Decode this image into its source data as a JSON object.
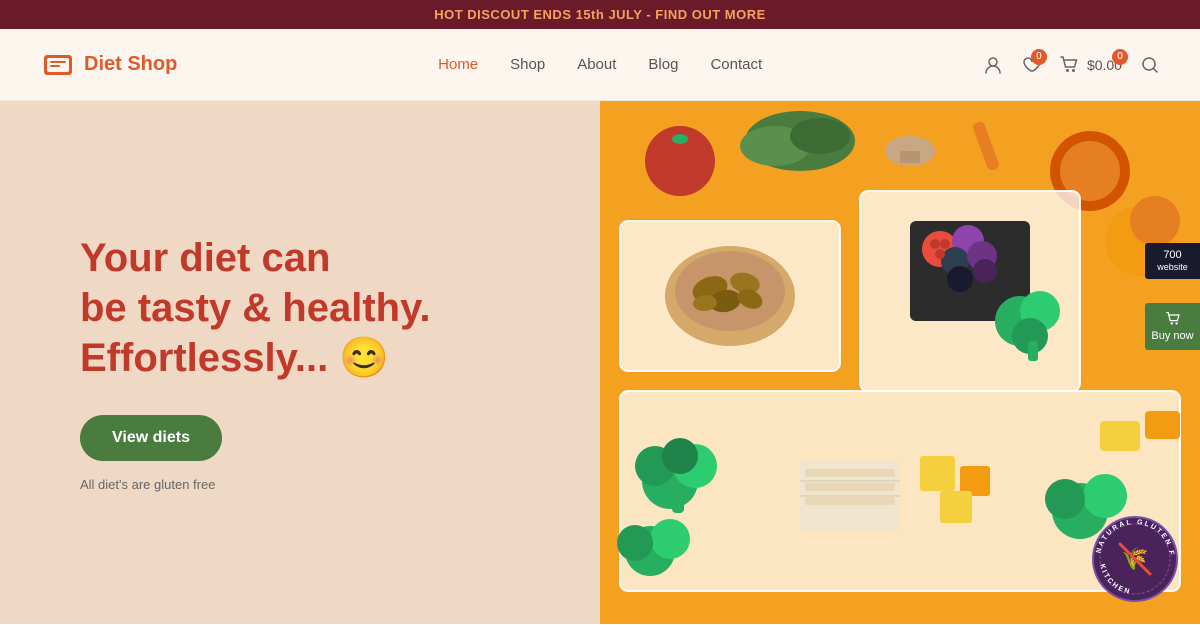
{
  "banner": {
    "text": "HOT DISCOUT ENDS 15th JULY - FIND OUT MORE"
  },
  "header": {
    "logo_text": "Diet Shop",
    "nav": {
      "home": "Home",
      "shop": "Shop",
      "about": "About",
      "blog": "Blog",
      "contact": "Contact"
    },
    "cart_amount": "$0.00",
    "wishlist_badge": "0",
    "cart_badge": "0"
  },
  "hero": {
    "headline_line1": "Your diet can",
    "headline_line2": "be tasty & healthy.",
    "headline_line3": "Effortlessly... 😊",
    "button_label": "View diets",
    "subtext": "All diet's are gluten free"
  },
  "sidebar": {
    "widget_label": "700",
    "buy_label": "Buy now"
  }
}
